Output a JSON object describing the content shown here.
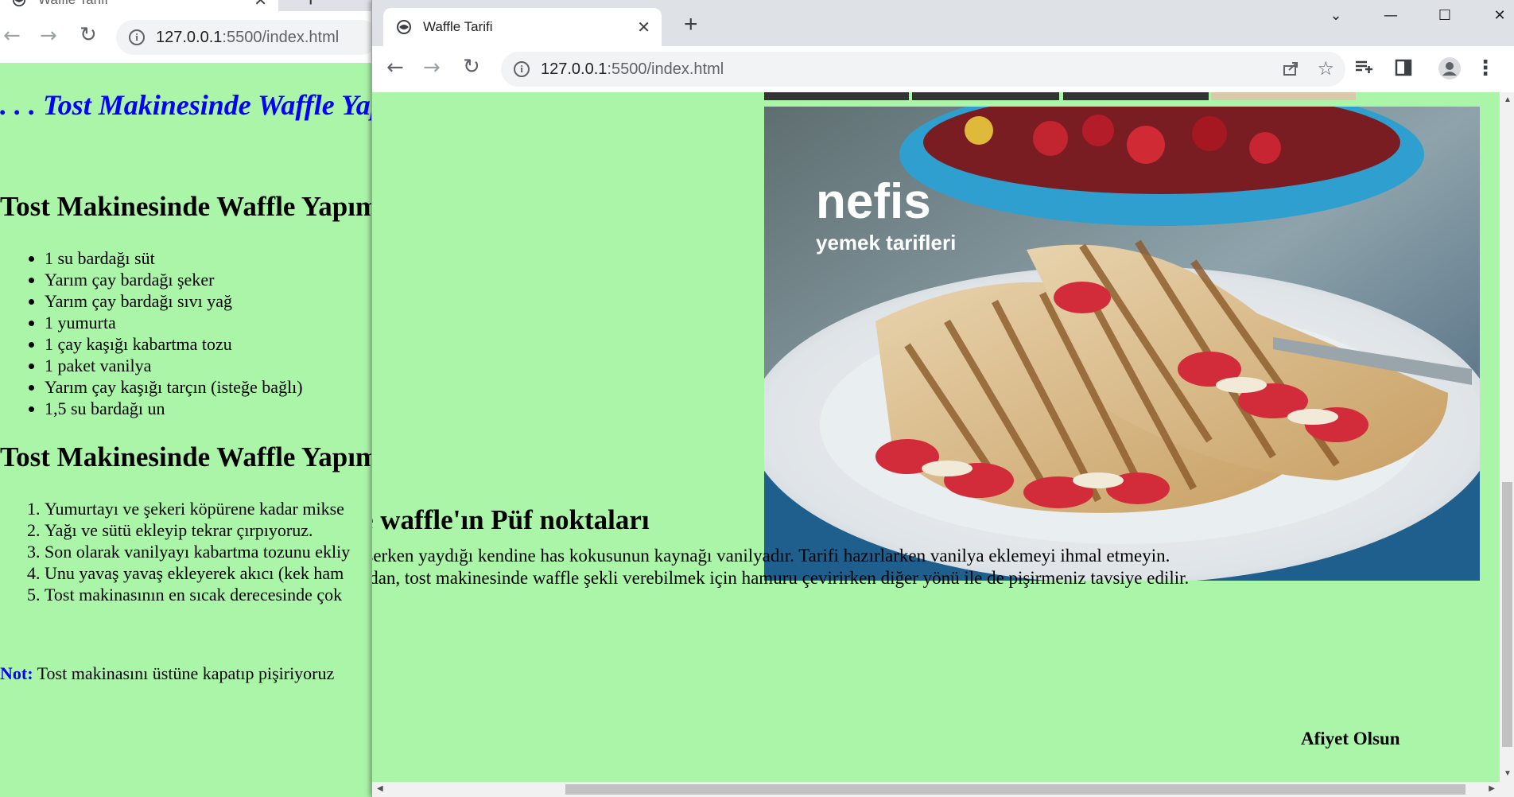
{
  "back_window": {
    "tab_title": "Waffle Tarifi",
    "url_host": "127.0.0.1",
    "url_rest": ":5500/index.html",
    "page": {
      "heading": ". . . Tost Makinesinde Waffle Yap",
      "section1_title": "Tost Makinesinde Waffle Yapım",
      "ingredients": [
        "1 su bardağı süt",
        "Yarım çay bardağı şeker",
        "Yarım çay bardağı sıvı yağ",
        "1 yumurta",
        "1 çay kaşığı kabartma tozu",
        "1 paket vanilya",
        "Yarım çay kaşığı tarçın (isteğe bağlı)",
        "1,5 su bardağı un"
      ],
      "section2_title": "Tost Makinesinde Waffle Yapım",
      "steps": [
        "Yumurtayı ve şekeri köpürene kadar mikse",
        "Yağı ve sütü ekleyip tekrar çırpıyoruz.",
        "Son olarak vanilyayı kabartma tozunu ekliy",
        "Unu yavaş yavaş ekleyerek akıcı (kek ham",
        "Tost makinasının en sıcak derecesinde çok"
      ],
      "note_label": "Not:",
      "note_text": " Tost makinasını üstüne kapatıp pişiriyoruz"
    }
  },
  "front_window": {
    "tab_title": "Waffle Tarifi",
    "new_tab": "+",
    "url_host": "127.0.0.1",
    "url_rest": ":5500/index.html",
    "page": {
      "image_logo_main": "nefis",
      "image_logo_sub": "yemek tarifleri",
      "tips_title": "e waffle'ın Püf noktaları",
      "tip1": "işerken yaydığı kendine has kokusunun kaynağı vanilyadır. Tarifi hazırlarken vanilya eklemeyi ihmal etmeyin.",
      "tip2": "adan, tost makinesinde waffle şekli verebilmek için hamuru çevirirken diğer yönü ile de pişirmeniz tavsiye edilir.",
      "closing": "Afiyet Olsun"
    }
  },
  "colors": {
    "page_background": "#abf5a9",
    "heading_blue": "#0000ff",
    "chrome_frame": "#dee1e6"
  }
}
